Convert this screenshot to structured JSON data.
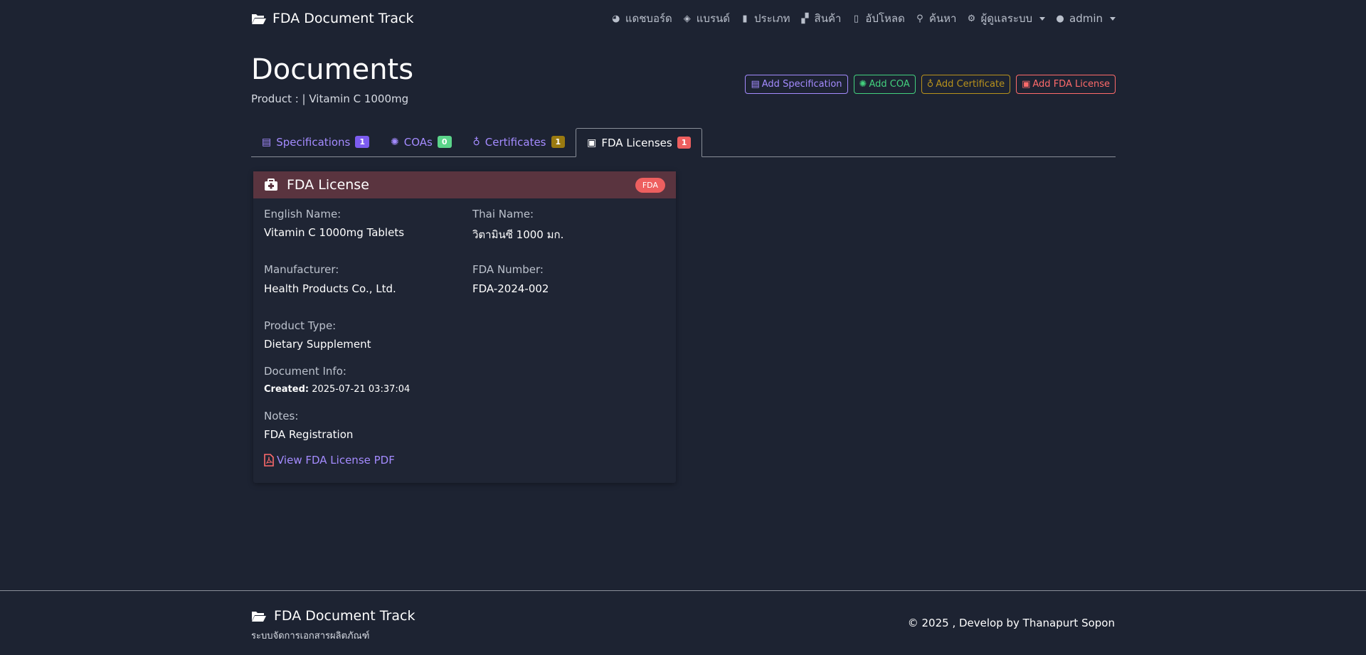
{
  "navbar": {
    "brand": "FDA Document Track",
    "items": [
      {
        "icon": "dashboard-icon",
        "glyph": "◕",
        "label": "แดชบอร์ด"
      },
      {
        "icon": "tags-icon",
        "glyph": "◈",
        "label": "แบรนด์"
      },
      {
        "icon": "clipboard-icon",
        "glyph": "▮",
        "label": "ประเภท"
      },
      {
        "icon": "boxes-icon",
        "glyph": "▞",
        "label": "สินค้า"
      },
      {
        "icon": "file-upload-icon",
        "glyph": "▯",
        "label": "อัปโหลด"
      },
      {
        "icon": "search-icon",
        "glyph": "⚲",
        "label": "ค้นหา"
      },
      {
        "icon": "gear-icon",
        "glyph": "⚙",
        "label": "ผู้ดูแลระบบ"
      },
      {
        "icon": "user-circle-icon",
        "glyph": "●",
        "label": "admin"
      }
    ]
  },
  "header": {
    "title": "Documents",
    "product": "Product : | Vitamin C 1000mg"
  },
  "actions": {
    "add_spec": "Add Specification",
    "add_coa": "Add COA",
    "add_cert": "Add Certificate",
    "add_fda": "Add FDA License"
  },
  "tabs": [
    {
      "label": "Specifications",
      "count": "1"
    },
    {
      "label": "COAs",
      "count": "0"
    },
    {
      "label": "Certificates",
      "count": "1"
    },
    {
      "label": "FDA Licenses",
      "count": "1"
    }
  ],
  "card": {
    "title": "FDA License",
    "badge": "FDA",
    "english_name_label": "English Name:",
    "english_name": "Vitamin C 1000mg Tablets",
    "thai_name_label": "Thai Name:",
    "thai_name": "วิตามินซี 1000 มก.",
    "manufacturer_label": "Manufacturer:",
    "manufacturer": "Health Products Co., Ltd.",
    "fda_number_label": "FDA Number:",
    "fda_number": "FDA-2024-002",
    "product_type_label": "Product Type:",
    "product_type": "Dietary Supplement",
    "doc_info_label": "Document Info:",
    "created_label": "Created:",
    "created_value": "2025-07-21 03:37:04",
    "notes_label": "Notes:",
    "notes": "FDA Registration",
    "pdf_link": "View FDA License PDF"
  },
  "footer": {
    "brand": "FDA Document Track",
    "subtitle": "ระบบจัดการเอกสารผลิตภัณฑ์",
    "copyright": "© 2025 , Develop by Thanapurt Sopon"
  },
  "colors": {
    "background": "#1d2332",
    "accent_purple": "#a48bff",
    "accent_green": "#43d17e",
    "accent_gold": "#b8921c",
    "accent_red": "#ff6b6b",
    "card_header": "#5a343f"
  }
}
